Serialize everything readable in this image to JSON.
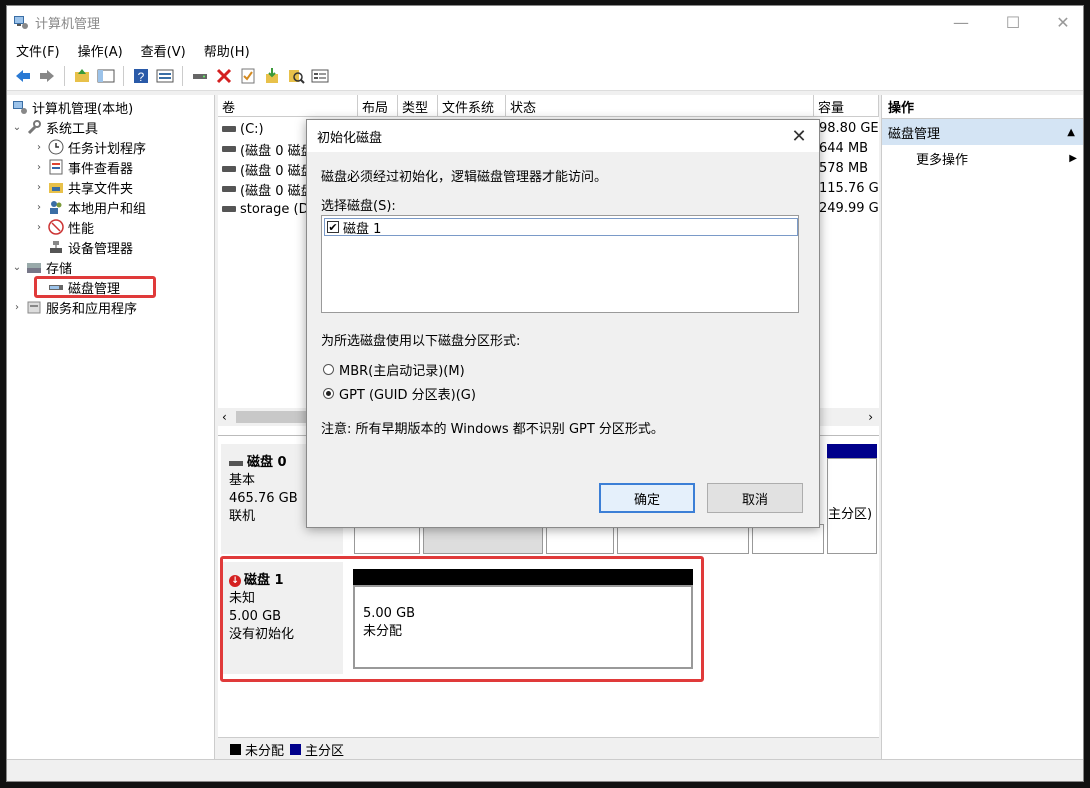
{
  "window": {
    "title": "计算机管理"
  },
  "menu": [
    "文件(F)",
    "操作(A)",
    "查看(V)",
    "帮助(H)"
  ],
  "tree": {
    "root": "计算机管理(本地)",
    "system_tools": "系统工具",
    "task_scheduler": "任务计划程序",
    "event_viewer": "事件查看器",
    "shared_folders": "共享文件夹",
    "local_users": "本地用户和组",
    "performance": "性能",
    "device_manager": "设备管理器",
    "storage": "存储",
    "disk_management": "磁盘管理",
    "services_apps": "服务和应用程序"
  },
  "volume_table": {
    "columns": [
      "卷",
      "布局",
      "类型",
      "文件系统",
      "状态",
      "容量"
    ],
    "rows": [
      {
        "volume": "(C:)",
        "capacity": "98.80 GE"
      },
      {
        "volume": "(磁盘 0 磁盘",
        "capacity": "644 MB"
      },
      {
        "volume": "(磁盘 0 磁盘",
        "capacity": "578 MB"
      },
      {
        "volume": "(磁盘 0 磁盘",
        "capacity": "115.76 G"
      },
      {
        "volume": "storage (D",
        "capacity": "249.99 G"
      }
    ]
  },
  "disks": {
    "disk0": {
      "name": "磁盘 0",
      "type": "基本",
      "size": "465.76 GB",
      "status": "联机",
      "partial_label": "主分区)"
    },
    "disk1": {
      "name": "磁盘 1",
      "type": "未知",
      "size": "5.00 GB",
      "status": "没有初始化",
      "part_size": "5.00 GB",
      "part_status": "未分配"
    }
  },
  "legend": {
    "unallocated": "未分配",
    "primary": "主分区"
  },
  "actions": {
    "header": "操作",
    "section": "磁盘管理",
    "more": "更多操作"
  },
  "dialog": {
    "title": "初始化磁盘",
    "message": "磁盘必须经过初始化，逻辑磁盘管理器才能访问。",
    "select_label": "选择磁盘(S):",
    "disk_item": "磁盘 1",
    "partition_label": "为所选磁盘使用以下磁盘分区形式:",
    "mbr": "MBR(主启动记录)(M)",
    "gpt": "GPT (GUID 分区表)(G)",
    "note": "注意: 所有早期版本的 Windows 都不识别 GPT 分区形式。",
    "ok": "确定",
    "cancel": "取消"
  },
  "colors": {
    "highlight": "#e03a3a",
    "primary_partition": "#00008b",
    "unallocated": "#000000"
  }
}
